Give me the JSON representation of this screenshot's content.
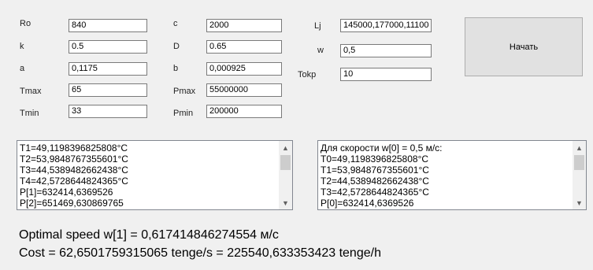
{
  "params": {
    "ro": {
      "label": "Ro",
      "value": "840"
    },
    "k": {
      "label": "k",
      "value": "0.5"
    },
    "a": {
      "label": "a",
      "value": "0,1175"
    },
    "tmax": {
      "label": "Tmax",
      "value": "65"
    },
    "tmin": {
      "label": "Tmin",
      "value": "33"
    },
    "c": {
      "label": "c",
      "value": "2000"
    },
    "d": {
      "label": "D",
      "value": "0.65"
    },
    "b": {
      "label": "b",
      "value": "0,000925"
    },
    "pmax": {
      "label": "Pmax",
      "value": "55000000"
    },
    "pmin": {
      "label": "Pmin",
      "value": "200000"
    },
    "lj": {
      "label": "Lj",
      "value": "145000,177000,11100"
    },
    "w": {
      "label": "w",
      "value": "0,5"
    },
    "tokr": {
      "label": "Tokp",
      "value": "10"
    }
  },
  "start_button": {
    "label": "Начать"
  },
  "log_left": {
    "lines": [
      "T1=49,1198396825808°C",
      "T2=53,9848767355601°C",
      "T3=44,5389482662438°C",
      "T4=42,5728644824365°C",
      "P[1]=632414,6369526",
      "P[2]=651469,630869765"
    ]
  },
  "log_right": {
    "lines": [
      "Для скорости w[0] = 0,5 м/с:",
      "T0=49,1198396825808°C",
      "T1=53,9848767355601°C",
      "T2=44,5389482662438°C",
      "T3=42,5728644824365°C",
      "P[0]=632414,6369526"
    ]
  },
  "results": {
    "line1": "Optimal speed w[1] = 0,617414846274554 м/с",
    "line2": "Cost = 62,6501759315065 tenge/s = 225540,633353423 tenge/h"
  }
}
